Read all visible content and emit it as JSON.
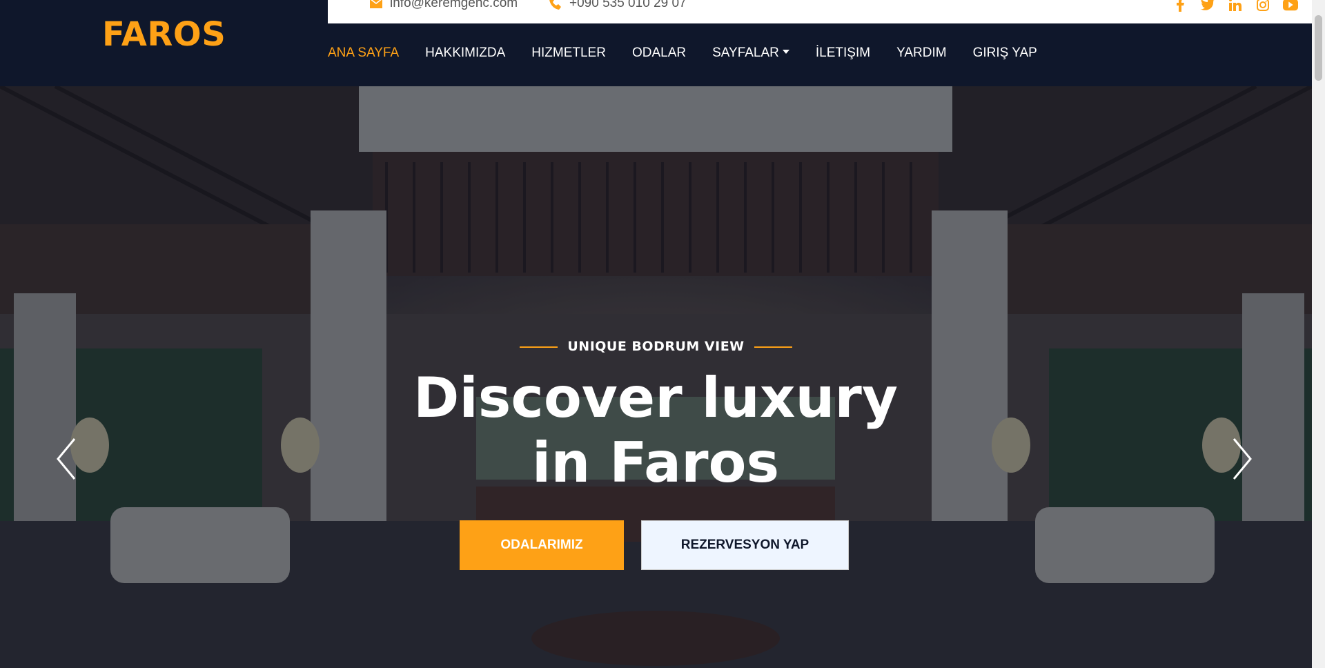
{
  "brand": {
    "name": "FAROS"
  },
  "topbar": {
    "email": "info@keremgenc.com",
    "phone": "+090 535 010 29 07",
    "socials": [
      "facebook-icon",
      "twitter-icon",
      "linkedin-icon",
      "instagram-icon",
      "youtube-icon"
    ]
  },
  "nav": {
    "items": [
      {
        "label": "ANA SAYFA",
        "active": true
      },
      {
        "label": "HAKKIMIZDA"
      },
      {
        "label": "HIZMETLER"
      },
      {
        "label": "ODALAR"
      },
      {
        "label": "SAYFALAR",
        "dropdown": true
      },
      {
        "label": "İLETIŞIM"
      },
      {
        "label": "YARDIM"
      },
      {
        "label": "GIRIŞ YAP"
      }
    ]
  },
  "hero": {
    "subtitle": "UNIQUE BODRUM VIEW",
    "headline": "Discover luxury in Faros",
    "primary_button": "ODALARIMIZ",
    "secondary_button": "REZERVESYON YAP"
  },
  "colors": {
    "accent": "#fea116",
    "navy": "#0f172b",
    "light_button": "#eef5ff"
  }
}
